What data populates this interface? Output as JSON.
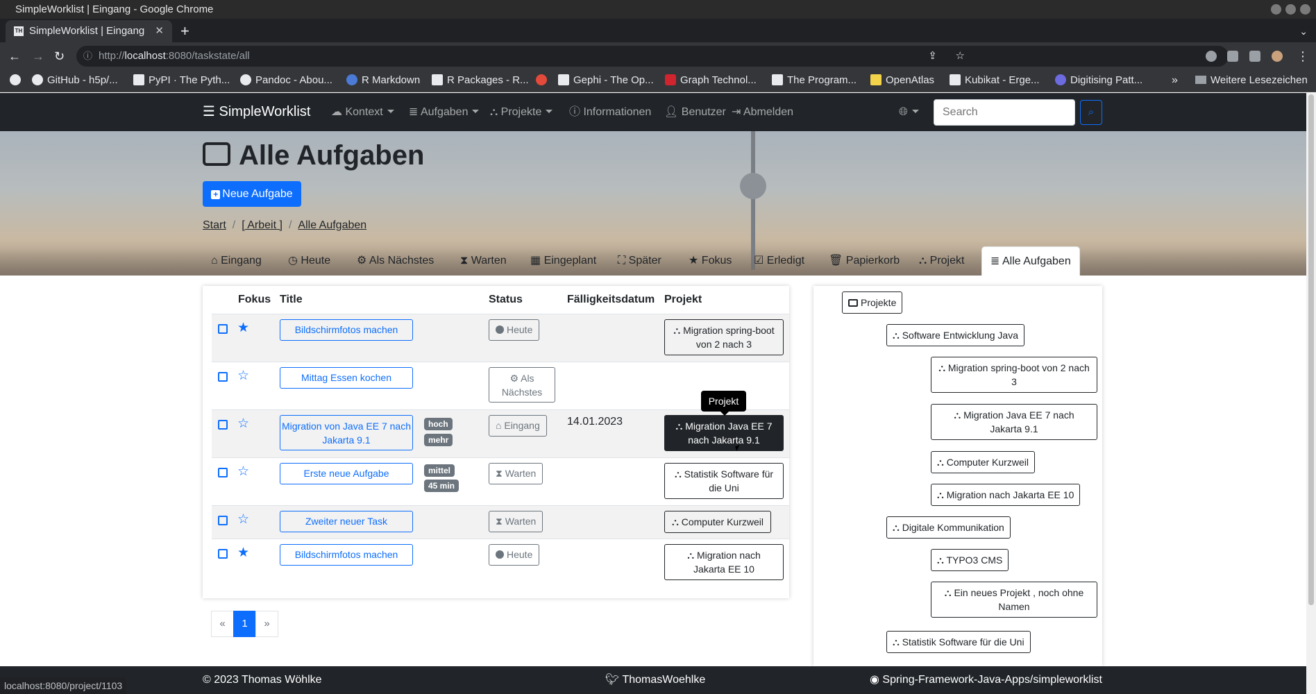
{
  "os": {
    "window_title": "SimpleWorklist | Eingang - Google Chrome"
  },
  "browser": {
    "tab_title": "SimpleWorklist | Eingang",
    "tab_favicon": "TH",
    "url_host": "localhost",
    "url_rest": ":8080/taskstate/all",
    "url_prefix": "http://",
    "bookmarks": [
      "GitHub - h5p/...",
      "PyPI · The Pyth...",
      "Pandoc - Abou...",
      "R Markdown",
      "R Packages - R...",
      "Gephi - The Op...",
      "Graph Technol...",
      "The Program...",
      "OpenAtlas",
      "Kubikat - Erge...",
      "Digitising Patt..."
    ],
    "bookmarks_more": "»",
    "bookmarks_other": "Weitere Lesezeichen",
    "status_url": "localhost:8080/project/1103"
  },
  "navbar": {
    "brand": "SimpleWorklist",
    "items": [
      "Kontext",
      "Aufgaben",
      "Projekte",
      "Informationen",
      "Benutzer",
      "Abmelden"
    ],
    "search_placeholder": "Search"
  },
  "page": {
    "title": "Alle Aufgaben",
    "new_task_label": "Neue Aufgabe",
    "breadcrumb": [
      "Start",
      "[ Arbeit ]",
      "Alle Aufgaben"
    ]
  },
  "tabs": [
    "Eingang",
    "Heute",
    "Als Nächstes",
    "Warten",
    "Eingeplant",
    "Später",
    "Fokus",
    "Erledigt",
    "Papierkorb",
    "Projekt",
    "Alle Aufgaben"
  ],
  "table": {
    "headers": [
      "Fokus",
      "Title",
      "Status",
      "Fälligkeitsdatum",
      "Projekt"
    ],
    "rows": [
      {
        "focus": true,
        "title": "Bildschirmfotos machen",
        "badges": [],
        "status": "Heute",
        "due": "",
        "project": "Migration spring-boot von 2 nach 3"
      },
      {
        "focus": false,
        "title": "Mittag Essen kochen",
        "badges": [],
        "status": "Als Nächstes",
        "due": "",
        "project": ""
      },
      {
        "focus": false,
        "title": "Migration von Java EE 7 nach Jakarta 9.1",
        "badges": [
          "hoch",
          "mehr"
        ],
        "status": "Eingang",
        "due": "14.01.2023",
        "project": "Migration Java EE 7 nach Jakarta 9.1"
      },
      {
        "focus": false,
        "title": "Erste neue Aufgabe",
        "badges": [
          "mittel",
          "45 min"
        ],
        "status": "Warten",
        "due": "",
        "project": "Statistik Software für die Uni"
      },
      {
        "focus": false,
        "title": "Zweiter neuer Task",
        "badges": [],
        "status": "Warten",
        "due": "",
        "project": "Computer Kurzweil"
      },
      {
        "focus": true,
        "title": "Bildschirmfotos machen",
        "badges": [],
        "status": "Heute",
        "due": "",
        "project": "Migration nach Jakarta EE 10"
      }
    ],
    "tooltip": "Projekt"
  },
  "pagination": {
    "prev": "«",
    "current": "1",
    "next": "»"
  },
  "project_tree": {
    "root": "Projekte",
    "nodes": [
      "Software Entwicklung Java",
      "Migration spring-boot von 2 nach 3",
      "Migration Java EE 7 nach Jakarta 9.1",
      "Computer Kurzweil",
      "Migration nach Jakarta EE 10",
      "Digitale Kommunikation",
      "TYPO3 CMS",
      "Ein neues Projekt , noch ohne Namen",
      "Statistik Software für die Uni"
    ]
  },
  "footer": {
    "copyright": "© 2023 Thomas Wöhlke",
    "twitter": "ThomasWoehlke",
    "github": "Spring-Framework-Java-Apps/simpleworklist"
  },
  "colors": {
    "primary": "#0d6efd",
    "navbar": "#212529",
    "secondary": "#6c757d"
  }
}
